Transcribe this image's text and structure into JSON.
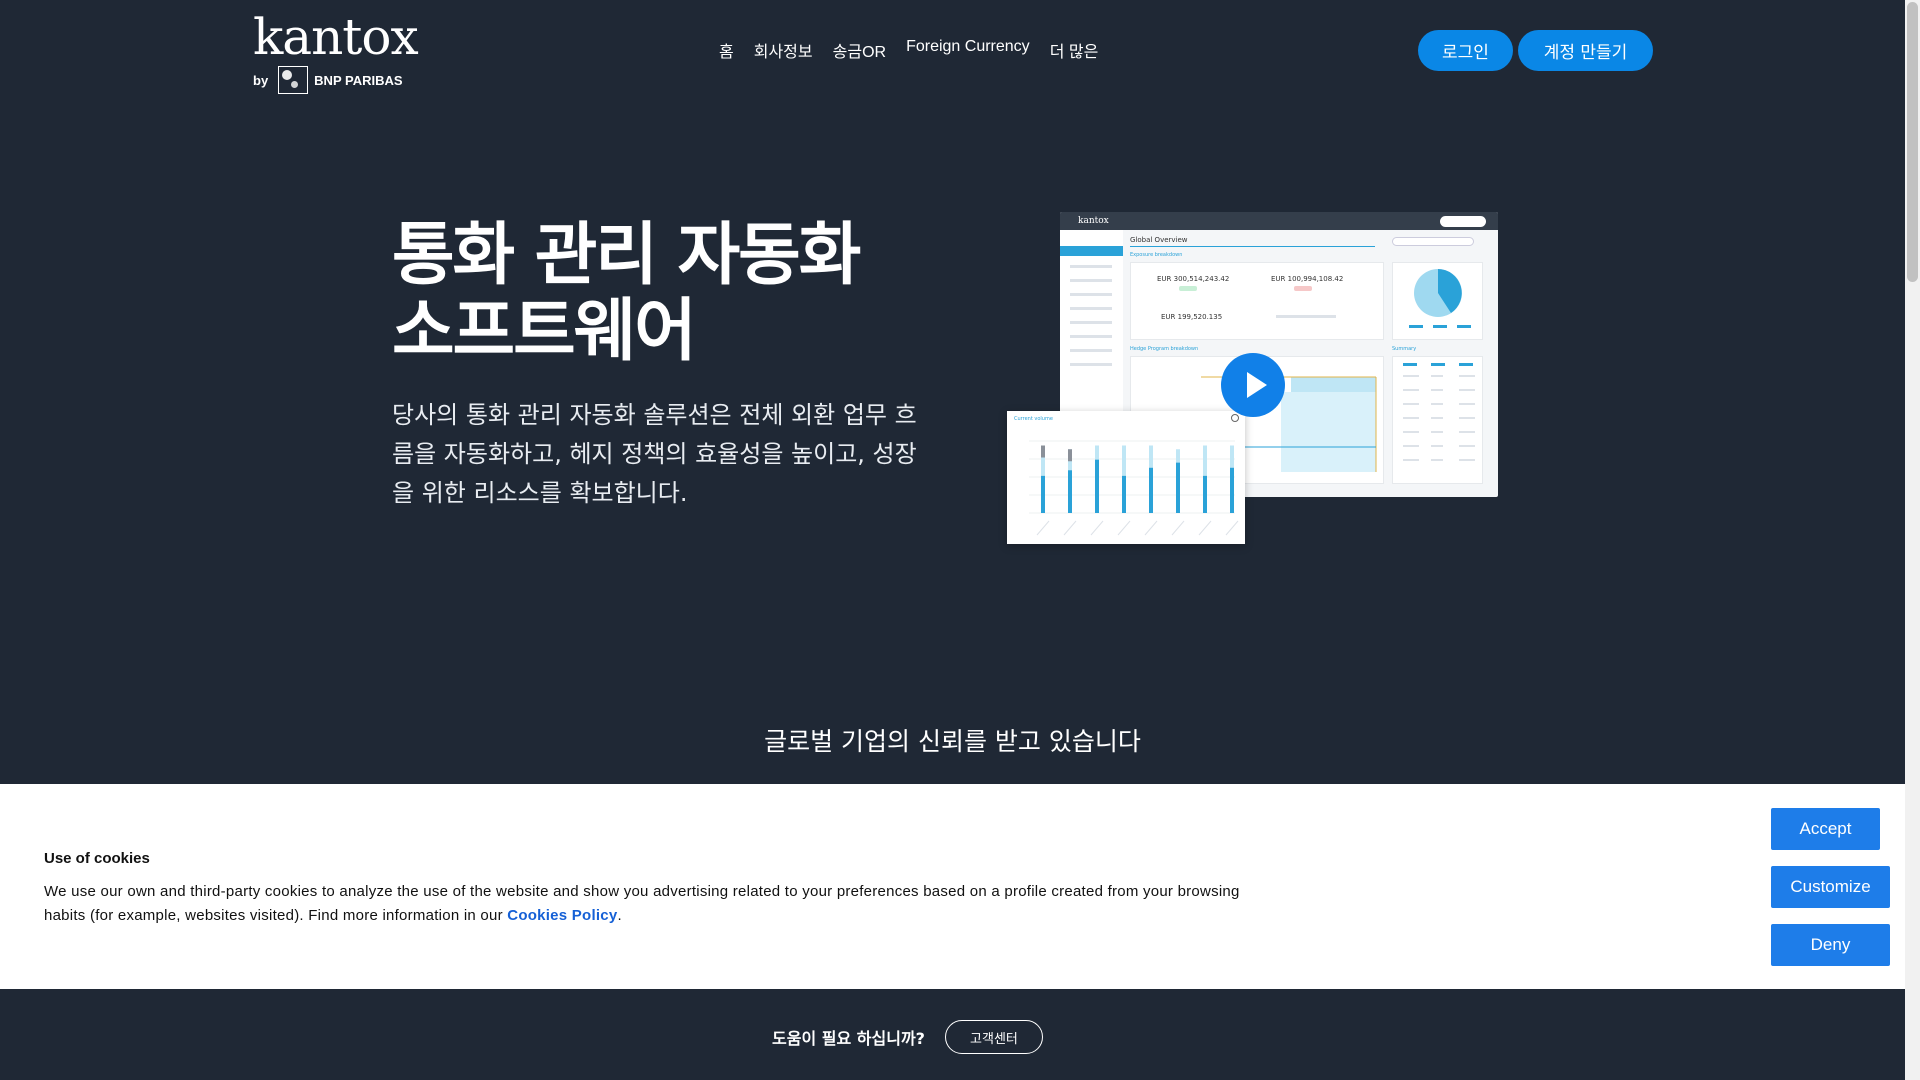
{
  "header": {
    "logo": {
      "word": "kantox",
      "by": "by",
      "partner": "BNP PARIBAS"
    },
    "nav": [
      "홈",
      "회사정보",
      "송금OR",
      "Foreign Currency",
      "더 많은"
    ],
    "login_label": "로그인",
    "signup_label": "계정 만들기",
    "accent_color": "#0a87e6"
  },
  "hero": {
    "title_line1": "통화 관리 자동화",
    "title_line2": "소프트웨어",
    "subtitle": "당사의 통화 관리 자동화 솔루션은 전체 외환 업무 흐름을 자동화하고, 헤지 정책의 효율성을 높이고, 성장을 위한 리소스를 확보합니다."
  },
  "dashboard_preview": {
    "brand": "kantox",
    "panel_title": "Global Overview",
    "section_exposure": "Exposure breakdown",
    "amount1": "EUR 300,514,243.42",
    "amount2": "EUR 100,994,108.42",
    "amount3": "EUR 199,520.135",
    "section_hedge": "Hedge Program breakdown",
    "section_summary": "Summary",
    "volume_title": "Current volume",
    "volume_bars": [
      0.9,
      0.85,
      0.9,
      0.9,
      0.9,
      0.85,
      0.9,
      0.9
    ]
  },
  "trusted": {
    "text": "글로벌 기업의 신뢰를 받고 있습니다"
  },
  "cookie": {
    "title": "Use of cookies",
    "text": "We use our own and third-party cookies to analyze the use of the website and show you advertising related to your preferences based on a profile created from your browsing habits (for example, websites visited). Find more information in our ",
    "link": "Cookies Policy",
    "period": ".",
    "accept": "Accept",
    "customize": "Customize",
    "deny": "Deny"
  },
  "help": {
    "text": "도움이 필요 하십니까?",
    "button": "고객센터"
  }
}
